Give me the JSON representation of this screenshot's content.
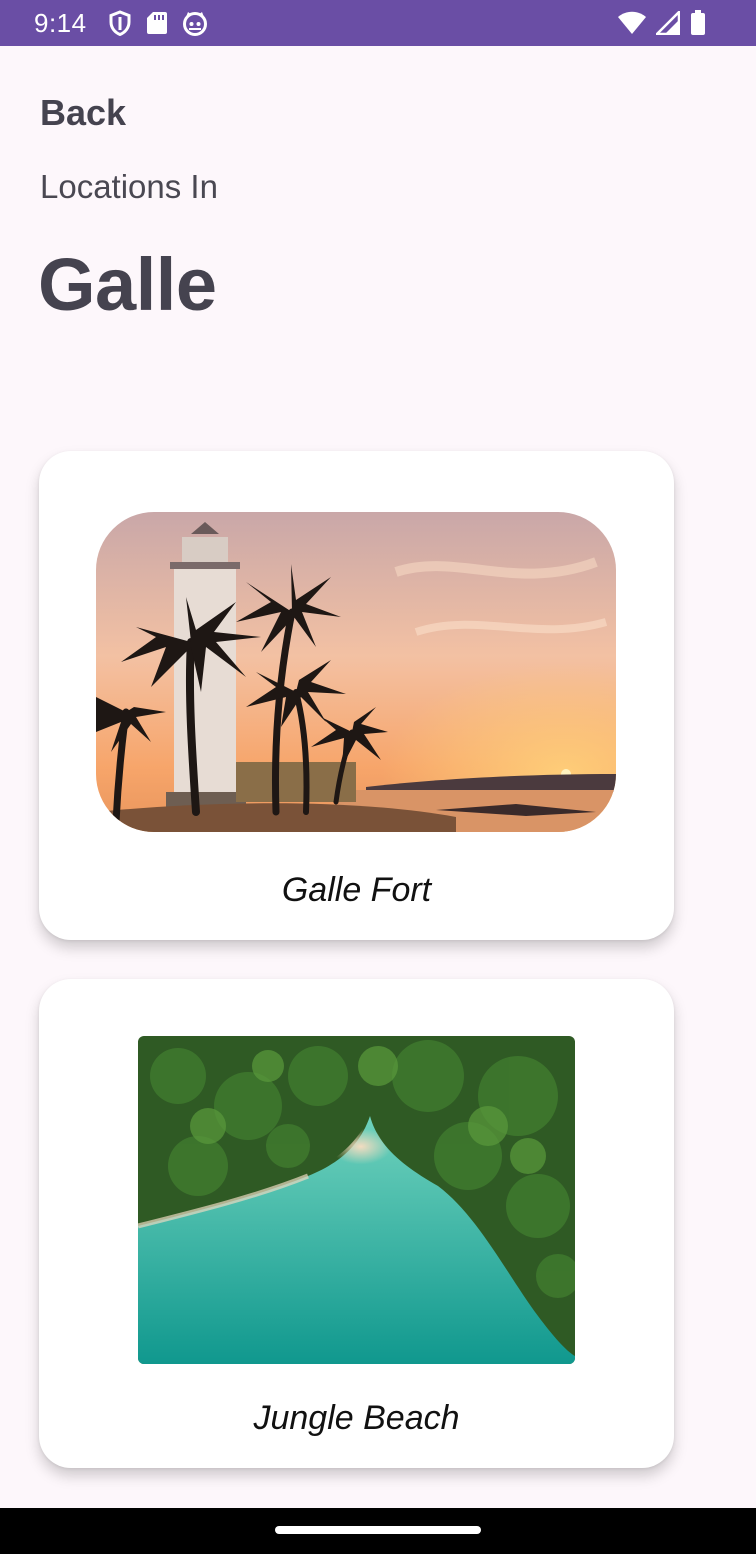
{
  "status_bar": {
    "time": "9:14",
    "left_icons": [
      "shield-icon",
      "sd-card-icon",
      "cat-face-icon"
    ],
    "right_icons": [
      "wifi-icon",
      "cell-signal-icon",
      "battery-icon"
    ],
    "color": "#6a4ea5"
  },
  "header": {
    "back_label": "Back",
    "subtitle": "Locations In",
    "title": "Galle"
  },
  "locations": [
    {
      "name": "Galle Fort",
      "image": "lighthouse-sunset-photo"
    },
    {
      "name": "Jungle Beach",
      "image": "aerial-beach-photo"
    }
  ]
}
